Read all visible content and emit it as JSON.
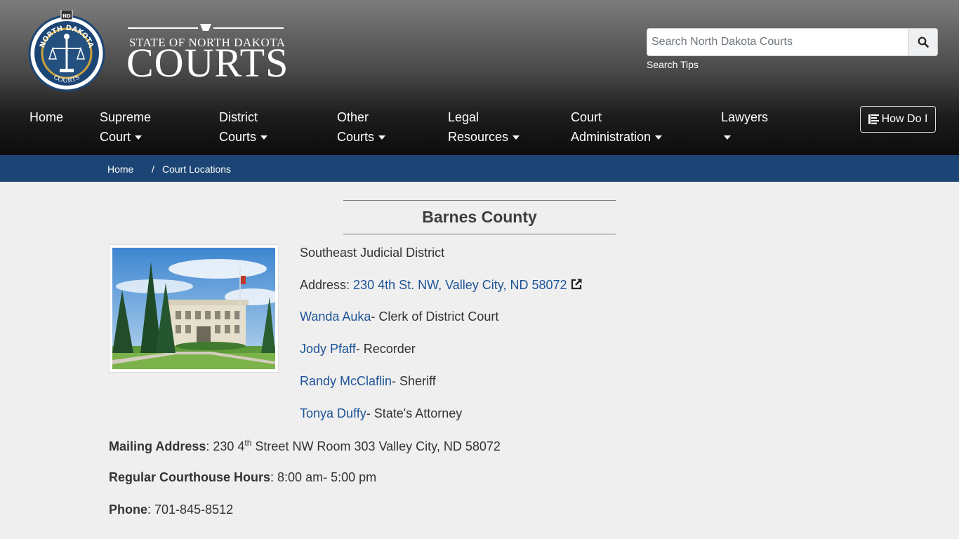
{
  "header": {
    "seal": {
      "top_text": "NORTH DAKOTA",
      "bottom_text": "COURTS",
      "badge": "ND"
    },
    "brand": {
      "line1": "STATE OF NORTH DAKOTA",
      "line2": "COURTS"
    },
    "search": {
      "placeholder": "Search North Dakota Courts",
      "tips_label": "Search Tips",
      "button_icon": "search-icon"
    }
  },
  "nav": {
    "home": "Home",
    "supreme_1": "Supreme",
    "supreme_2": "Court",
    "district_1": "District",
    "district_2": "Courts",
    "other_1": "Other",
    "other_2": "Courts",
    "legal_1": "Legal",
    "legal_2": "Resources",
    "admin_1": "Court",
    "admin_2": "Administration",
    "lawyers": "Lawyers",
    "how_do_i": "How Do I"
  },
  "breadcrumb": {
    "home": "Home",
    "separator": "/",
    "current": "Court Locations"
  },
  "county": {
    "title": "Barnes County",
    "district": "Southeast Judicial District",
    "address_label": "Address: ",
    "address": "230 4th St. NW, Valley City, ND 58072",
    "officials": [
      {
        "name": "Wanda Auka",
        "role": "- Clerk of District Court"
      },
      {
        "name": "Jody Pfaff",
        "role": "- Recorder"
      },
      {
        "name": "Randy McClaflin",
        "role": "- Sheriff"
      },
      {
        "name": "Tonya Duffy",
        "role": "- State's Attorney"
      }
    ],
    "mailing_label": "Mailing Address",
    "mailing_pre": ": 230 4",
    "mailing_sup": "th",
    "mailing_post": " Street NW Room 303 Valley City, ND 58072",
    "hours_label": "Regular Courthouse Hours",
    "hours": ": 8:00 am- 5:00 pm",
    "phone_label": "Phone",
    "phone": ":  701-845-8512"
  },
  "colors": {
    "link": "#1d5496",
    "breadcrumb_bar": "#1c4474",
    "seal_blue": "#1c4474",
    "seal_gold": "#c9a23a"
  }
}
